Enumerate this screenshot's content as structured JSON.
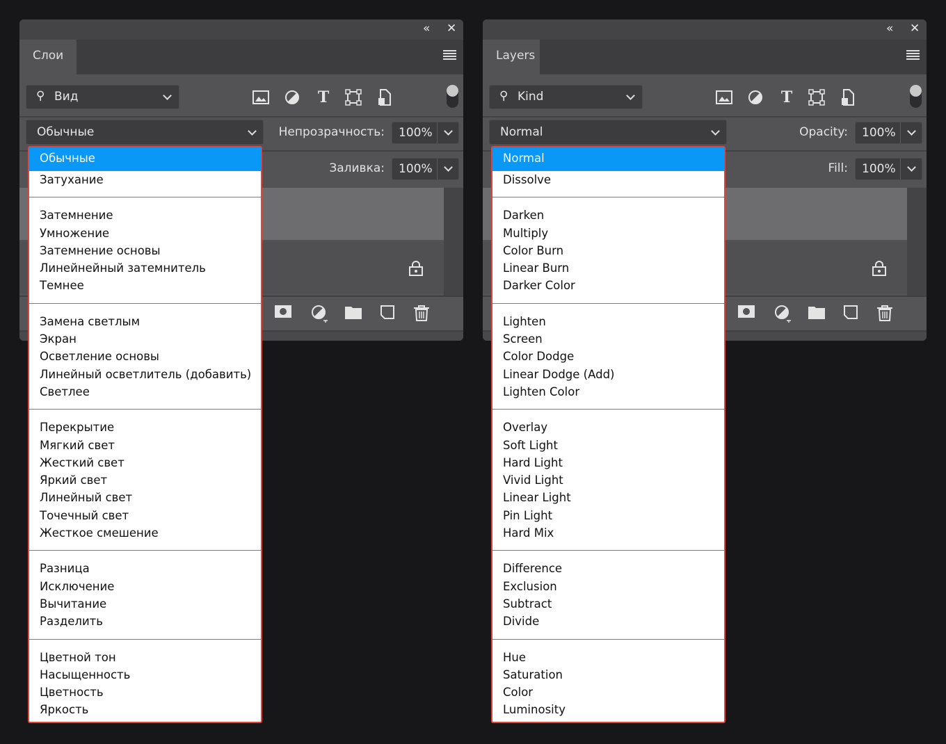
{
  "panels": [
    {
      "id": "ru",
      "tab": "Слои",
      "kind": "Вид",
      "blend": "Обычные",
      "opacity_label": "Непрозрачность:",
      "opacity": "100%",
      "fill_label": "Заливка:",
      "fill": "100%",
      "menu_groups": [
        [
          "Обычные",
          "Затухание"
        ],
        [
          "Затемнение",
          "Умножение",
          "Затемнение основы",
          "Линейнейный затемнитель",
          "Темнее"
        ],
        [
          "Замена светлым",
          "Экран",
          "Осветление основы",
          "Линейный осветлитель (добавить)",
          "Светлее"
        ],
        [
          "Перекрытие",
          "Мягкий свет",
          "Жесткий свет",
          "Яркий свет",
          "Линейный свет",
          "Точечный свет",
          "Жесткое смешение"
        ],
        [
          "Разница",
          "Исключение",
          "Вычитание",
          "Разделить"
        ],
        [
          "Цветной тон",
          "Насыщенность",
          "Цветность",
          "Яркость"
        ]
      ]
    },
    {
      "id": "en",
      "tab": "Layers",
      "kind": "Kind",
      "blend": "Normal",
      "opacity_label": "Opacity:",
      "opacity": "100%",
      "fill_label": "Fill:",
      "fill": "100%",
      "menu_groups": [
        [
          "Normal",
          "Dissolve"
        ],
        [
          "Darken",
          "Multiply",
          "Color Burn",
          "Linear Burn",
          "Darker Color"
        ],
        [
          "Lighten",
          "Screen",
          "Color Dodge",
          "Linear Dodge (Add)",
          "Lighten Color"
        ],
        [
          "Overlay",
          "Soft Light",
          "Hard Light",
          "Vivid Light",
          "Linear Light",
          "Pin Light",
          "Hard Mix"
        ],
        [
          "Difference",
          "Exclusion",
          "Subtract",
          "Divide"
        ],
        [
          "Hue",
          "Saturation",
          "Color",
          "Luminosity"
        ]
      ]
    }
  ],
  "colors": {
    "selected": "#0a98f6",
    "highlight_border": "#e0453b"
  }
}
